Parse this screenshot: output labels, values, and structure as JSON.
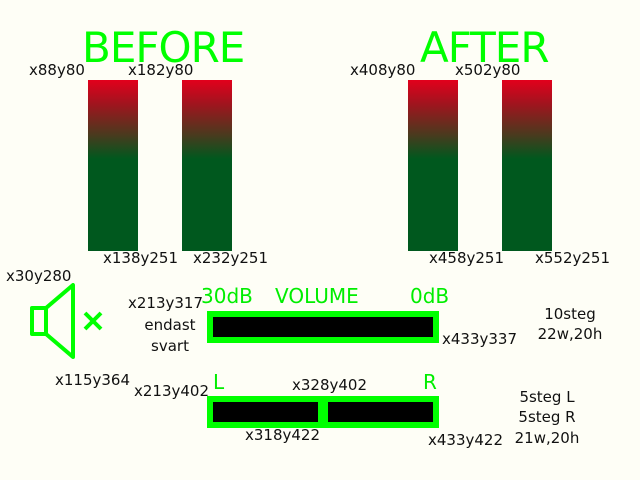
{
  "before": {
    "title": "BEFORE",
    "labels": [
      "x88y80",
      "x182y80",
      "x138y251",
      "x232y251"
    ]
  },
  "after": {
    "title": "AFTER",
    "labels": [
      "x408y80",
      "x502y80",
      "x458y251",
      "x552y251"
    ]
  },
  "speaker": {
    "icon": "speaker-muted-icon",
    "label_top": "x30y280",
    "label_bottom": "x115y364"
  },
  "volume": {
    "label_left": "30dB",
    "label_title": "VOLUME",
    "label_right": "0dB",
    "coord_tl": "x213y317",
    "note1": "endast",
    "note2": "svart",
    "coord_br": "x433y337",
    "info1": "10steg",
    "info2": "22w,20h"
  },
  "balance": {
    "label_left": "L",
    "label_right": "R",
    "coord_tl": "x213y402",
    "coord_mid": "x328y402",
    "coord_split": "x318y422",
    "coord_br": "x433y422",
    "info1": "5steg L",
    "info2": "5steg R",
    "info3": "21w,20h"
  },
  "colors": {
    "accent": "#00ff00",
    "bar_top": "#e2001c",
    "bar_bottom": "#00581e"
  }
}
